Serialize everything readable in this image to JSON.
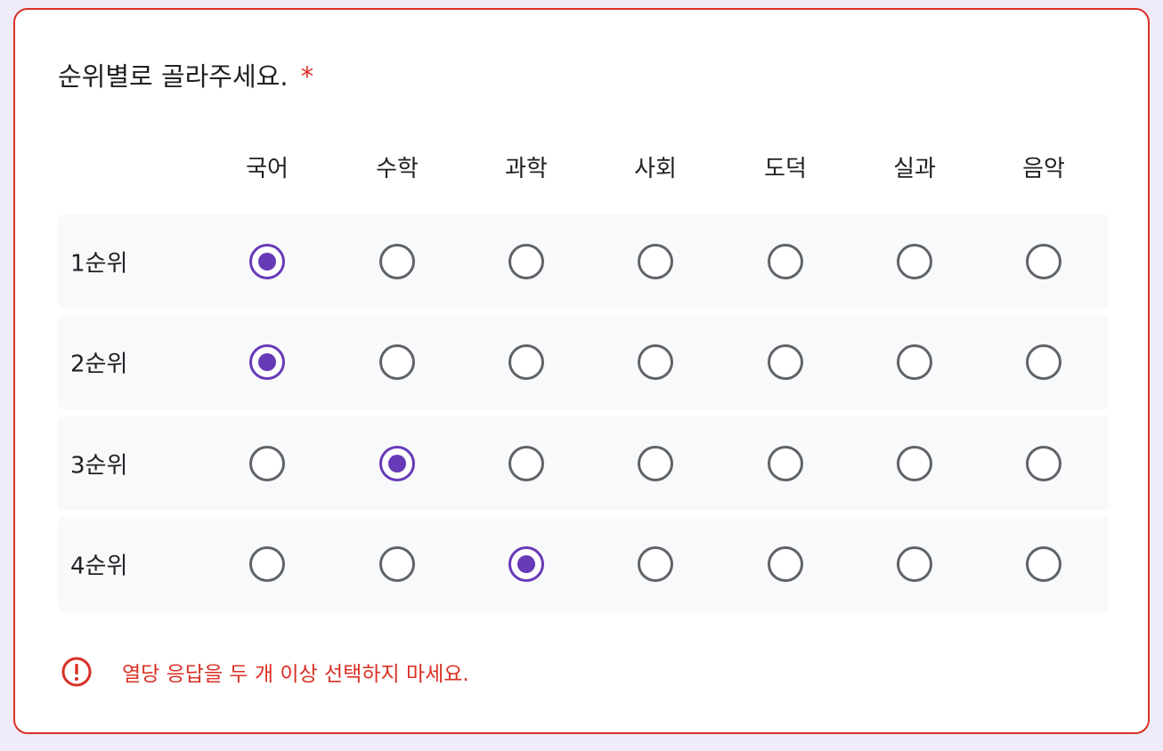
{
  "question": {
    "title": "순위별로 골라주세요.",
    "required_mark": "*"
  },
  "columns": [
    "국어",
    "수학",
    "과학",
    "사회",
    "도덕",
    "실과",
    "음악"
  ],
  "rows": [
    {
      "label": "1순위",
      "selected": 0
    },
    {
      "label": "2순위",
      "selected": 0
    },
    {
      "label": "3순위",
      "selected": 1
    },
    {
      "label": "4순위",
      "selected": 2
    }
  ],
  "error": {
    "icon": "error-circle-icon",
    "message": "열당 응답을 두 개 이상 선택하지 마세요."
  },
  "colors": {
    "accent": "#673ab7",
    "error": "#d93025",
    "radio_border": "#5f6368",
    "row_bg": "#f8f9fa",
    "page_bg": "#f0ebf8"
  }
}
